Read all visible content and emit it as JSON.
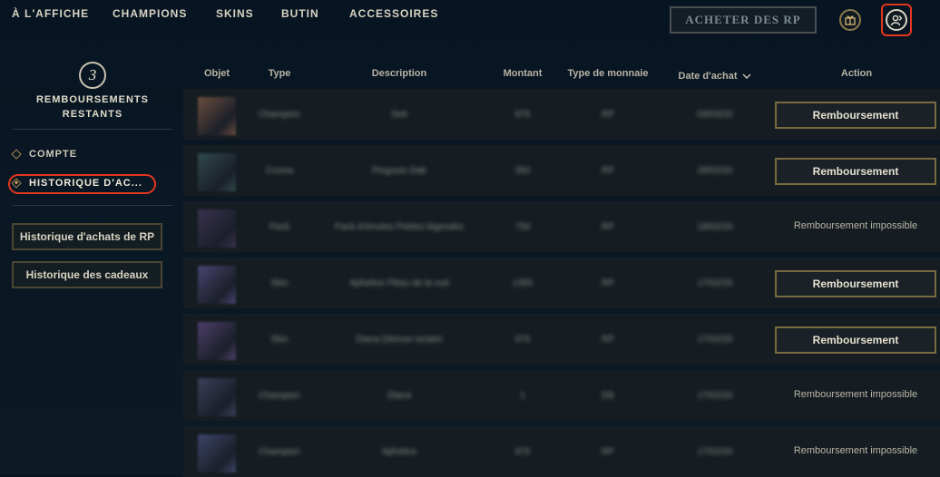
{
  "nav": {
    "items": [
      "À L'AFFICHE",
      "CHAMPIONS",
      "SKINS",
      "BUTIN",
      "ACCESSOIRES"
    ],
    "buy_rp_label": "ACHETER DES RP",
    "gift_icon": "gift-icon",
    "account_icon": "account-icon"
  },
  "sidebar": {
    "refunds_count": "3",
    "refunds_label_line1": "REMBOURSEMENTS",
    "refunds_label_line2": "RESTANTS",
    "links": [
      {
        "label": "COMPTE",
        "active": false
      },
      {
        "label": "HISTORIQUE D'AC...",
        "active": true
      }
    ],
    "buttons": [
      "Historique d'achats de RP",
      "Historique des cadeaux"
    ]
  },
  "table": {
    "headers": {
      "objet": "Objet",
      "type": "Type",
      "description": "Description",
      "montant": "Montant",
      "monnaie": "Type de monnaie",
      "date": "Date d'achat",
      "action": "Action"
    },
    "rows": [
      {
        "type": "Champion",
        "description": "Sett",
        "amount": "975",
        "currency": "RP",
        "date": "03/03/20",
        "action": "Remboursement",
        "refundable": true,
        "thumb_color": "#6b4d3e"
      },
      {
        "type": "Croma",
        "description": "Pingouin Dab",
        "amount": "350",
        "currency": "RP",
        "date": "28/02/20",
        "action": "Remboursement",
        "refundable": true,
        "thumb_color": "#2f4a4a"
      },
      {
        "type": "Pack",
        "description": "Pack d'émotes Petites légendes",
        "amount": "750",
        "currency": "RP",
        "date": "18/02/20",
        "action": "Remboursement impossible",
        "refundable": false,
        "thumb_color": "#3a3250"
      },
      {
        "type": "Skin",
        "description": "Aphelios Fléau de la nuit",
        "amount": "1350",
        "currency": "RP",
        "date": "17/02/20",
        "action": "Remboursement",
        "refundable": true,
        "thumb_color": "#4a4470"
      },
      {
        "type": "Skin",
        "description": "Diana Déesse lunaire",
        "amount": "975",
        "currency": "RP",
        "date": "17/02/20",
        "action": "Remboursement",
        "refundable": true,
        "thumb_color": "#4e3f6a"
      },
      {
        "type": "Champion",
        "description": "Diana",
        "amount": "1",
        "currency": "EB",
        "date": "17/02/20",
        "action": "Remboursement impossible",
        "refundable": false,
        "thumb_color": "#3c3f5a"
      },
      {
        "type": "Champion",
        "description": "Aphelios",
        "amount": "975",
        "currency": "RP",
        "date": "17/02/20",
        "action": "Remboursement impossible",
        "refundable": false,
        "thumb_color": "#3d4468"
      }
    ]
  },
  "colors": {
    "accent_gold": "#c8aa6e",
    "highlight_red": "#e3371e"
  }
}
